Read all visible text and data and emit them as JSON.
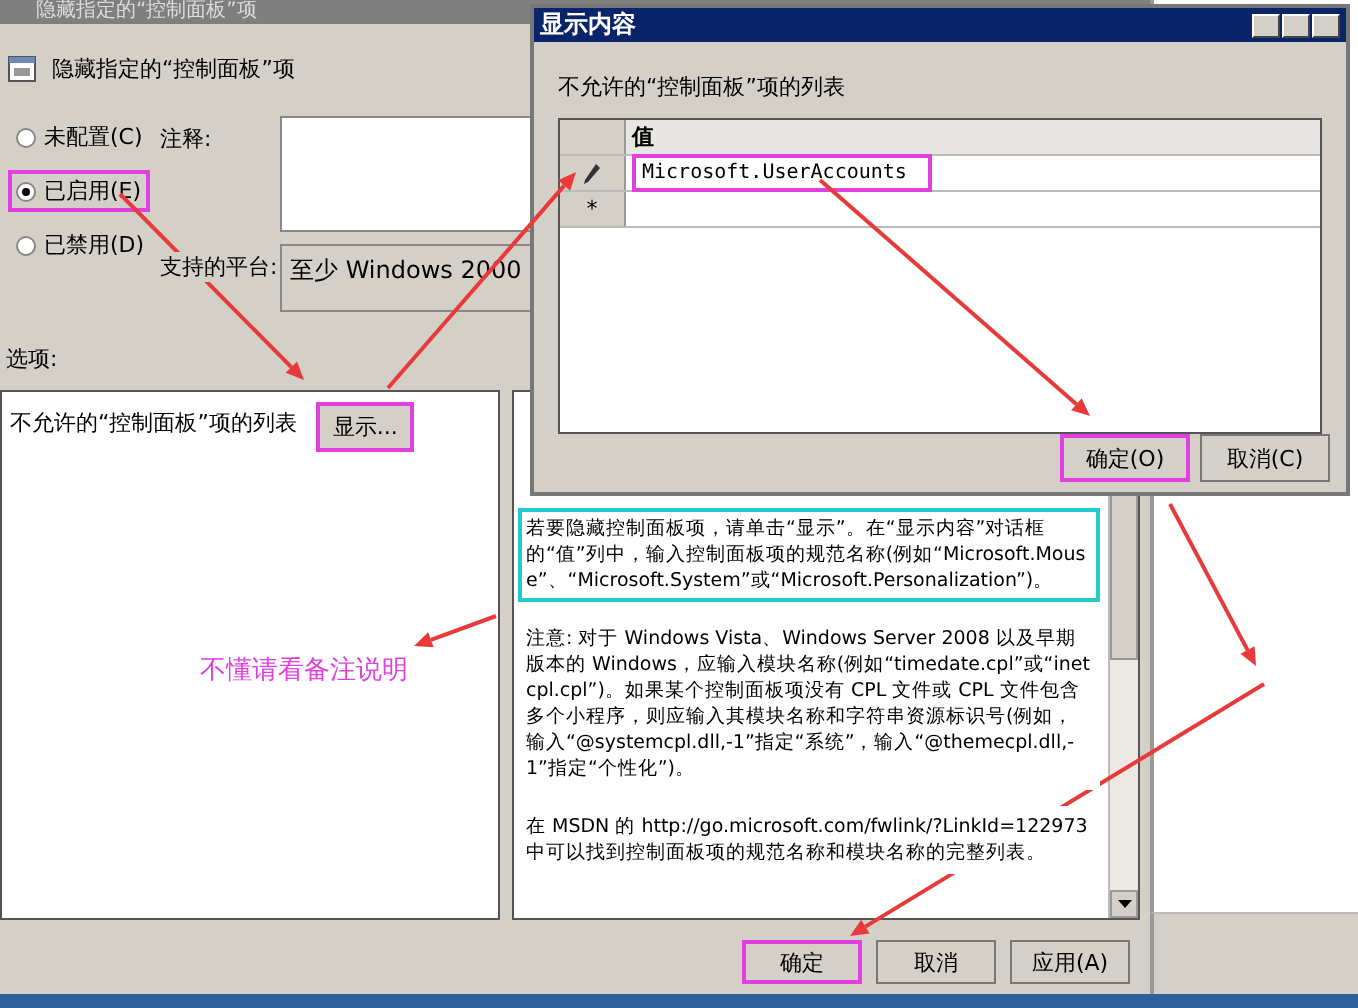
{
  "main_window": {
    "title": "隐藏指定的“控制面板”项",
    "header": "隐藏指定的“控制面板”项",
    "radios": [
      {
        "label": "未配置(C)",
        "selected": false,
        "highlighted": false
      },
      {
        "label": "已启用(E)",
        "selected": true,
        "highlighted": true
      },
      {
        "label": "已禁用(D)",
        "selected": false,
        "highlighted": false
      }
    ],
    "comment_label": "注释:",
    "platform_label": "支持的平台:",
    "platform": "至少 Windows 2000",
    "options_label": "选项:",
    "options": {
      "label": "不允许的“控制面板”项的列表",
      "button": {
        "label": "显示...",
        "highlighted": true
      }
    },
    "help": [
      {
        "text": "若要隐藏控制面板项，请单击“显示”。在“显示内容”对话框的“值”列中，输入控制面板项的规范名称(例如“Microsoft.Mouse”、“Microsoft.System”或“Microsoft.Personalization”)。",
        "highlighted": true
      },
      {
        "text": "注意: 对于 Windows Vista、Windows Server 2008 以及早期版本的 Windows，应输入模块名称(例如“timedate.cpl”或“inetcpl.cpl”)。如果某个控制面板项没有 CPL 文件或 CPL 文件包含多个小程序，则应输入其模块名称和字符串资源标识号(例如，输入“@systemcpl.dll,-1”指定“系统”，输入“@themecpl.dll,-1”指定“个性化”)。",
        "highlighted": false
      },
      {
        "text": "在 MSDN 的 http://go.microsoft.com/fwlink/?LinkId=122973 中可以找到控制面板项的规范名称和模块名称的完整列表。",
        "highlighted": false
      }
    ],
    "buttons": [
      {
        "label": "确定",
        "highlighted": true
      },
      {
        "label": "取消",
        "highlighted": false
      },
      {
        "label": "应用(A)",
        "highlighted": false
      }
    ]
  },
  "dialog": {
    "title": "显示内容",
    "label": "不允许的“控制面板”项的列表",
    "column": "值",
    "rows": [
      {
        "kind": "editing",
        "value": "Microsoft.UserAccounts",
        "highlighted": true
      },
      {
        "kind": "new",
        "marker": "*"
      }
    ],
    "buttons": [
      {
        "label": "确定(O)",
        "highlighted": true
      },
      {
        "label": "取消(C)",
        "highlighted": false
      }
    ]
  },
  "note": "不懂请看备注说明"
}
